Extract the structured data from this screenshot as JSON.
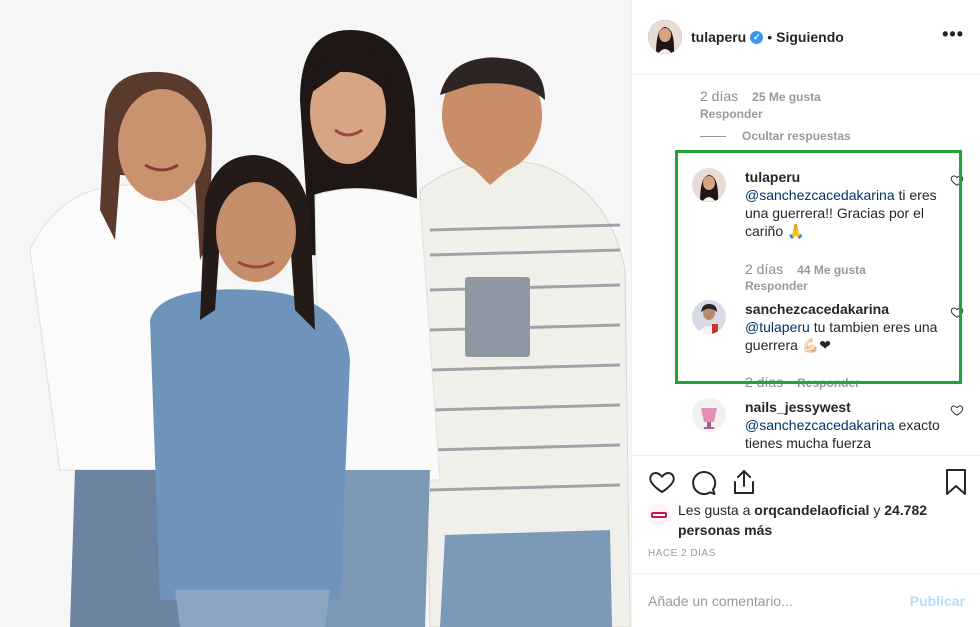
{
  "post": {
    "author": "tulaperu",
    "verified_icon": "verified-badge-icon",
    "separator": "•",
    "follow_status": "Siguiendo",
    "more_icon": "more-options-icon"
  },
  "comments": {
    "prev_meta": {
      "time": "2 días",
      "likes": "25 Me gusta",
      "reply": "Responder"
    },
    "hide_replies": "Ocultar respuestas",
    "items": [
      {
        "user": "tulaperu",
        "mention": "@sanchezcacedakarina",
        "text": " ti eres una guerrera!! Gracias por el cariño 🙏",
        "time": "2 días",
        "likes": "44 Me gusta",
        "reply": "Responder"
      },
      {
        "user": "sanchezcacedakarina",
        "mention": "@tulaperu",
        "text": " tu tambien eres una guerrera 💪🏻❤",
        "time": "2 días",
        "likes": "",
        "reply": "Responder"
      },
      {
        "user": "nails_jessywest",
        "mention": "@sanchezcacedakarina",
        "text": " exacto tienes mucha fuerza"
      }
    ]
  },
  "actions": {
    "like_icon": "heart-icon",
    "comment_icon": "comment-icon",
    "share_icon": "share-icon",
    "save_icon": "bookmark-icon"
  },
  "likes_summary": {
    "prefix": "Les gusta a ",
    "user": "orqcandelaoficial",
    "middle": " y ",
    "count": "24.782 personas más"
  },
  "time_ago": "HACE 2 DÍAS",
  "comment_box": {
    "placeholder": "Añade un comentario...",
    "publish_label": "Publicar"
  },
  "colors": {
    "highlight": "#22a43a",
    "link": "#003569",
    "publish_disabled": "#b2dffc",
    "verified": "#3897f0"
  }
}
